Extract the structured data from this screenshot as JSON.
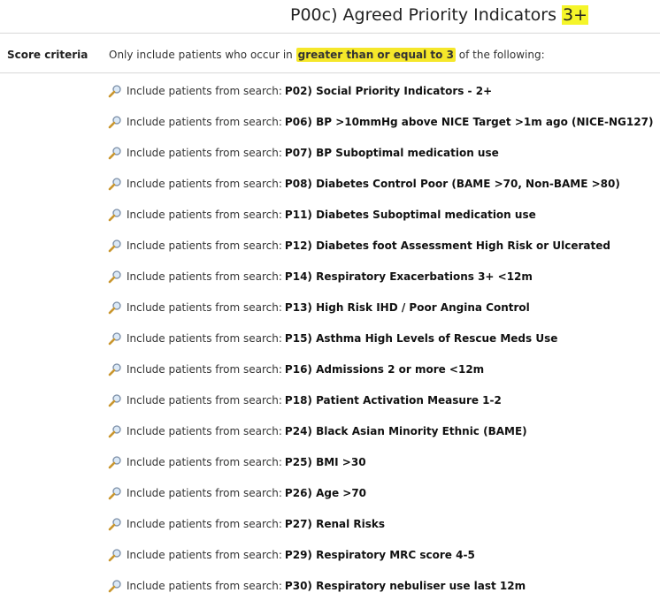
{
  "title": {
    "text": "P00c) Agreed Priority Indicators",
    "highlight": "3+"
  },
  "criteria": {
    "label": "Score criteria",
    "before": "Only include patients who occur in",
    "highlight": "greater than or equal to 3",
    "after": "of the following:"
  },
  "row_prefix": "Include patients from search:",
  "searches": [
    {
      "code": "P02)",
      "name": "Social Priority Indicators - 2+"
    },
    {
      "code": "P06)",
      "name": "BP >10mmHg above NICE Target >1m ago (NICE-NG127)"
    },
    {
      "code": "P07)",
      "name": "BP Suboptimal medication use"
    },
    {
      "code": "P08)",
      "name": "Diabetes Control Poor (BAME >70, Non-BAME >80)"
    },
    {
      "code": "P11)",
      "name": "Diabetes Suboptimal medication use"
    },
    {
      "code": "P12)",
      "name": "Diabetes foot Assessment High Risk or Ulcerated"
    },
    {
      "code": "P14)",
      "name": "Respiratory Exacerbations 3+ <12m"
    },
    {
      "code": "P13)",
      "name": "High Risk IHD / Poor Angina Control"
    },
    {
      "code": "P15)",
      "name": "Asthma High Levels of Rescue Meds Use"
    },
    {
      "code": "P16)",
      "name": "Admissions 2 or more <12m"
    },
    {
      "code": "P18)",
      "name": "Patient Activation Measure 1-2"
    },
    {
      "code": "P24)",
      "name": "Black Asian Minority Ethnic (BAME)"
    },
    {
      "code": "P25)",
      "name": "BMI >30"
    },
    {
      "code": "P26)",
      "name": "Age >70"
    },
    {
      "code": "P27)",
      "name": "Renal Risks"
    },
    {
      "code": "P29)",
      "name": "Respiratory MRC score 4-5"
    },
    {
      "code": "P30)",
      "name": "Respiratory nebuliser use last 12m"
    }
  ],
  "icons": {
    "search_row_icon": "magnifier-icon"
  },
  "colors": {
    "highlight_title": "#f5f52a",
    "highlight_criteria": "#f5e72a"
  }
}
